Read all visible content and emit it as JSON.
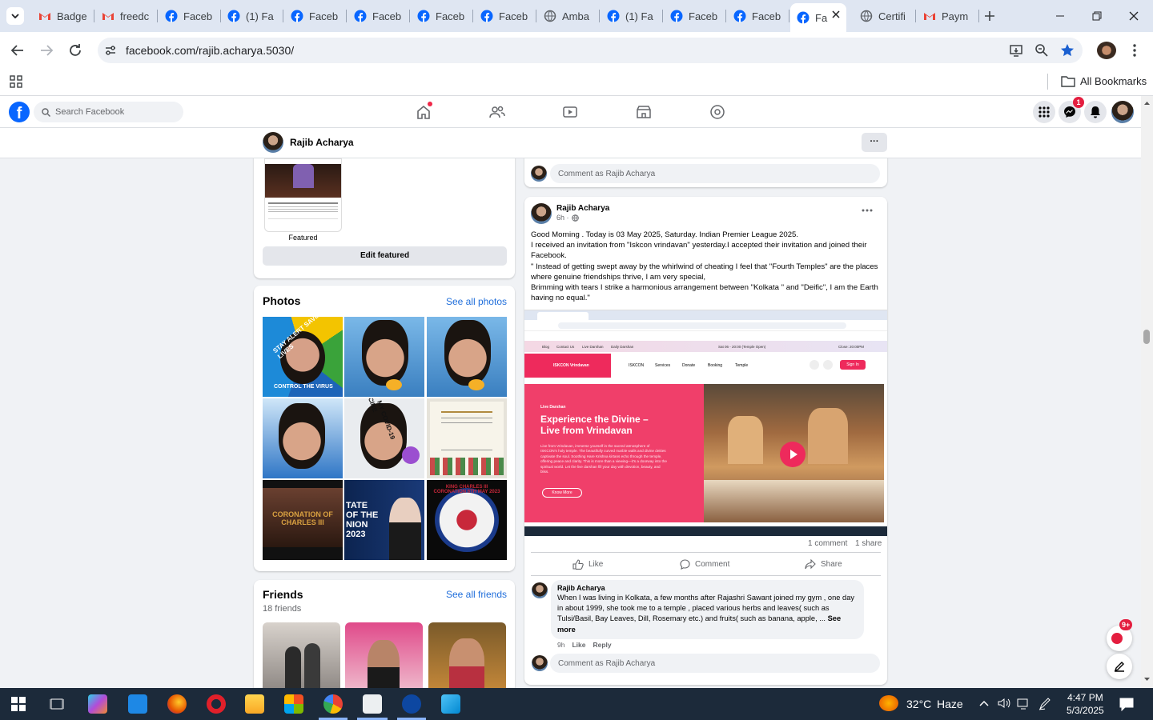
{
  "browser": {
    "tabs": [
      {
        "label": "Badge",
        "icon": "gmail-icon"
      },
      {
        "label": "freedc",
        "icon": "gmail-icon"
      },
      {
        "label": "Faceb",
        "icon": "facebook-icon"
      },
      {
        "label": "(1) Fa",
        "icon": "facebook-icon"
      },
      {
        "label": "Faceb",
        "icon": "facebook-icon"
      },
      {
        "label": "Faceb",
        "icon": "facebook-icon"
      },
      {
        "label": "Faceb",
        "icon": "facebook-icon"
      },
      {
        "label": "Faceb",
        "icon": "facebook-icon"
      },
      {
        "label": "Amba",
        "icon": "globe-icon"
      },
      {
        "label": "(1) Fa",
        "icon": "facebook-icon"
      },
      {
        "label": "Faceb",
        "icon": "facebook-icon"
      },
      {
        "label": "Faceb",
        "icon": "facebook-icon"
      },
      {
        "label": "Fa",
        "icon": "facebook-icon",
        "active": true
      },
      {
        "label": "Certifi",
        "icon": "globe-icon"
      },
      {
        "label": "Paym",
        "icon": "gmail-icon"
      }
    ],
    "url": "facebook.com/rajib.acharya.5030/",
    "all_bookmarks": "All Bookmarks"
  },
  "fb": {
    "search_placeholder": "Search Facebook",
    "messenger_badge": "1",
    "profile_name": "Rajib Acharya",
    "more_btn": "···"
  },
  "left": {
    "featured_label": "Featured",
    "edit_featured": "Edit featured",
    "photos_title": "Photos",
    "see_all_photos": "See all photos",
    "photo_texts": [
      "STAY ALERT SAVE LIVES",
      "CONTROL THE VIRUS",
      "I GOT MY COVID-19 VACCINE",
      "CORONATION OF CHARLES III",
      "TATE OF THE NION 2023",
      "KING CHARLES III CORONATION 6TH MAY 2023"
    ],
    "friends_title": "Friends",
    "friends_count": "18 friends",
    "see_all_friends": "See all friends"
  },
  "post": {
    "comment_placeholder": "Comment as Rajib Acharya",
    "author": "Rajib Acharya",
    "time": "6h ·",
    "text_lines": [
      "Good Morning . Today is 03 May 2025, Saturday. Indian Premier League 2025.",
      "I received an invitation from \"Iskcon vrindavan\" yesterday.I accepted their invitation and joined their Facebook.",
      "\" Instead of getting swept away by the whirlwind of cheating I feel that \"Fourth Temples\" are the places where genuine friendships thrive, I am very special,",
      "Brimming with tears I strike a harmonious arrangement between \"Kolkata \" and \"Deific\", I am the Earth having no equal.\""
    ],
    "screenshot": {
      "nav": [
        "Blog",
        "Contact Us",
        "Live Darshan",
        "Daily Darshan"
      ],
      "time_open": "Sat 06 - 20:00 (Temple Open)",
      "closed": "Close: 20:00PM",
      "brand": "ISKCON Vrindavan",
      "menu": [
        "ISKCON",
        "Services",
        "Donate",
        "Booking",
        "Temple"
      ],
      "sign_in": "Sign In",
      "live_label": "Live Darshan",
      "headline": "Experience the Divine – Live from Vrindavan",
      "body": "Live from Vrindavan, immerse yourself in the sacred atmosphere of ISKCON's holy temple. The beautifully curved marble walls and divine deities captivate the soul. Soothing Hare Krishna kirtans echo through the temple, offering peace and clarity. This is more than a viewing—it's a doorway into the spiritual world. Let the live darshan fill your day with devotion, beauty, and bliss.",
      "know_more": "Know More"
    },
    "stats": {
      "comments": "1 comment",
      "shares": "1 share"
    },
    "actions": {
      "like": "Like",
      "comment": "Comment",
      "share": "Share"
    },
    "comment": {
      "author": "Rajib Acharya",
      "text": "When I was living in Kolkata, a few months after Rajashri Sawant joined my gym , one day in about 1999, she took me to a temple , placed various herbs and leaves( such as Tulsi/Basil, Bay Leaves, Dill, Rosemary etc.) and fruits( such as banana, apple, ...",
      "see_more": "See more",
      "time": "9h",
      "like": "Like",
      "reply": "Reply"
    }
  },
  "floating": {
    "news_badge": "9+"
  },
  "taskbar": {
    "weather": "32°C",
    "weather_desc": "Haze",
    "time": "4:47 PM",
    "date": "5/3/2025"
  },
  "colors": {
    "fb_blue": "#0866ff",
    "accent_red": "#f02849",
    "iskcon_pink": "#ee2a5c"
  }
}
